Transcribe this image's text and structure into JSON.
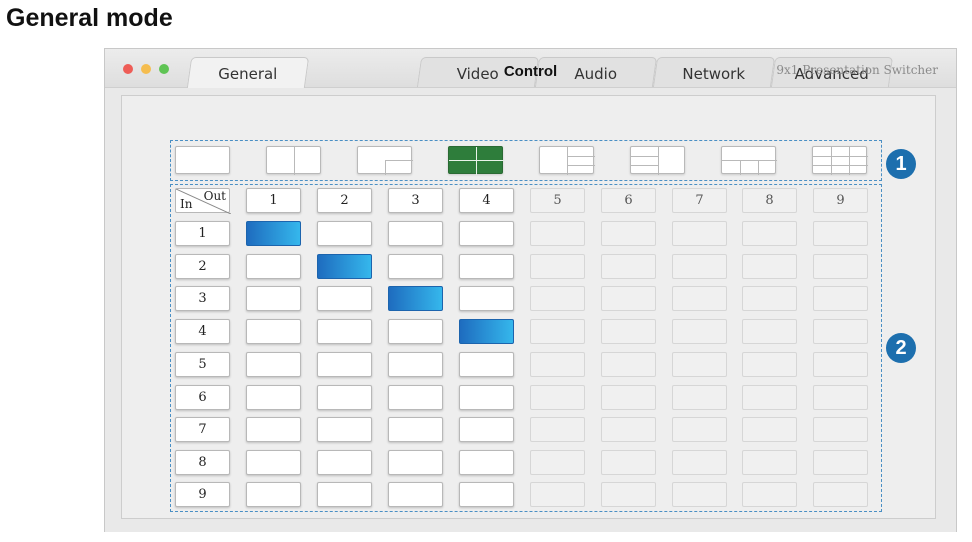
{
  "heading": "General mode",
  "window": {
    "app_title": "9x1 Presentation Switcher",
    "tabs": [
      {
        "label": "General",
        "active": true
      },
      {
        "label": "Video",
        "active": false
      },
      {
        "label": "Audio",
        "active": false
      },
      {
        "label": "Network",
        "active": false
      },
      {
        "label": "Advanced",
        "active": false
      }
    ]
  },
  "control": {
    "title": "Control",
    "layout_modes": [
      {
        "icon": "single-view-icon",
        "active": false
      },
      {
        "icon": "dual-split-icon",
        "active": false
      },
      {
        "icon": "pip-icon",
        "active": false
      },
      {
        "icon": "quad-view-icon",
        "active": true
      },
      {
        "icon": "one-left-two-right-icon",
        "active": false
      },
      {
        "icon": "two-left-one-right-icon",
        "active": false
      },
      {
        "icon": "one-top-three-bottom-icon",
        "active": false
      },
      {
        "icon": "six-view-icon",
        "active": false
      }
    ],
    "matrix": {
      "corner_in": "In",
      "corner_out": "Out",
      "outputs": [
        "1",
        "2",
        "3",
        "4",
        "5",
        "6",
        "7",
        "8",
        "9"
      ],
      "inputs": [
        "1",
        "2",
        "3",
        "4",
        "5",
        "6",
        "7",
        "8",
        "9"
      ],
      "enabled_outputs": 4,
      "routes": [
        {
          "input": "1",
          "output": "1"
        },
        {
          "input": "2",
          "output": "2"
        },
        {
          "input": "3",
          "output": "3"
        },
        {
          "input": "4",
          "output": "4"
        }
      ]
    }
  },
  "callouts": {
    "one": "1",
    "two": "2"
  },
  "colors": {
    "selected": "#1e6cbf",
    "active_mode": "#2e7d3b",
    "callout": "#1d6fae"
  }
}
